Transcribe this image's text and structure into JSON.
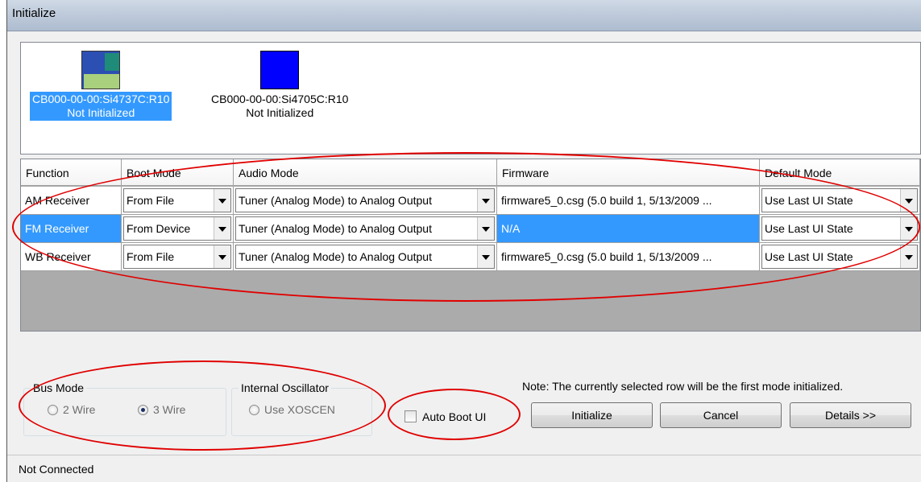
{
  "window": {
    "title": "Initialize"
  },
  "devices": [
    {
      "name": "CB000-00-00:Si4737C:R10",
      "status": "Not Initialized",
      "selected": true,
      "icon": "multi-tile-device-icon"
    },
    {
      "name": "CB000-00-00:Si4705C:R10",
      "status": "Not Initialized",
      "selected": false,
      "icon": "blue-square-device-icon"
    }
  ],
  "grid": {
    "headers": [
      "Function",
      "Boot Mode",
      "Audio Mode",
      "Firmware",
      "Default Mode"
    ],
    "rows": [
      {
        "function": "AM Receiver",
        "boot_mode": "From File",
        "audio_mode": "Tuner (Analog Mode) to Analog Output",
        "firmware": "firmware5_0.csg (5.0 build 1, 5/13/2009 ...",
        "default_mode": "Use Last UI State",
        "selected": false
      },
      {
        "function": "FM Receiver",
        "boot_mode": "From Device",
        "audio_mode": "Tuner (Analog Mode) to Analog Output",
        "firmware": "N/A",
        "default_mode": "Use Last UI State",
        "selected": true
      },
      {
        "function": "WB Receiver",
        "boot_mode": "From File",
        "audio_mode": "Tuner (Analog Mode) to Analog Output",
        "firmware": "firmware5_0.csg (5.0 build 1, 5/13/2009 ...",
        "default_mode": "Use Last UI State",
        "selected": false
      }
    ]
  },
  "bus_mode": {
    "legend": "Bus Mode",
    "options": [
      {
        "label": "2 Wire",
        "checked": false
      },
      {
        "label": "3 Wire",
        "checked": true
      }
    ]
  },
  "internal_oscillator": {
    "legend": "Internal Oscillator",
    "option": {
      "label": "Use XOSCEN",
      "checked": false
    }
  },
  "auto_boot": {
    "label": "Auto Boot UI",
    "checked": false
  },
  "note": "Note: The currently selected row will be the first mode initialized.",
  "buttons": {
    "initialize": "Initialize",
    "cancel": "Cancel",
    "details": "Details >>"
  },
  "status": "Not Connected",
  "colors": {
    "selection": "#3399ff",
    "annotation": "#e00000",
    "grid_background": "#ababab"
  }
}
